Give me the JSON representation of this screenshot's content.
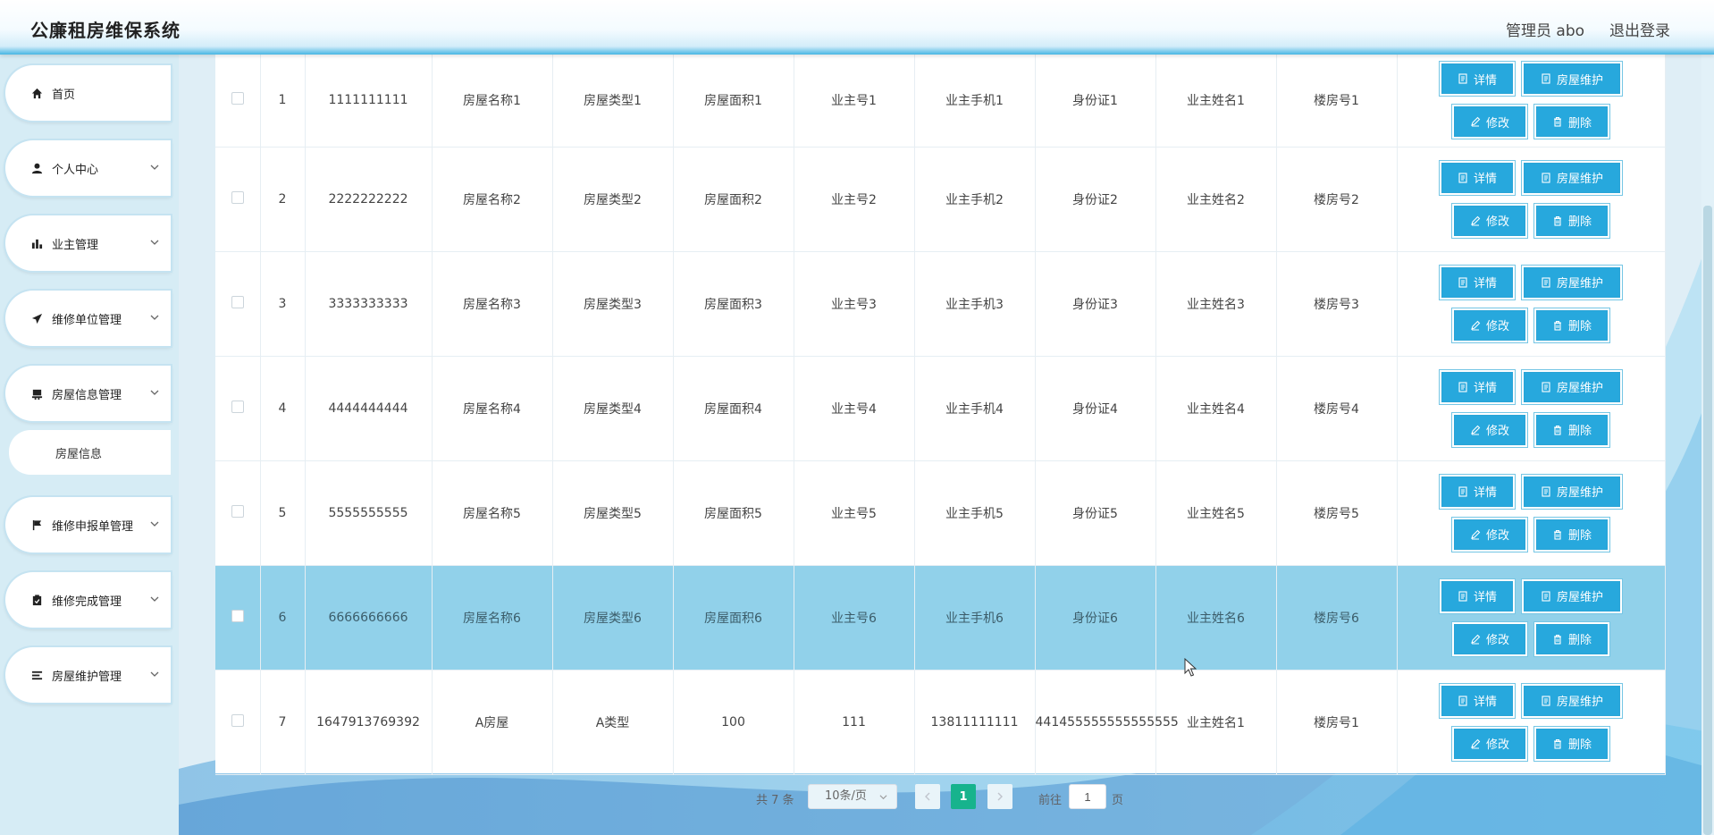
{
  "header": {
    "title": "公廉租房维保系统",
    "user": "管理员 abo",
    "logout": "退出登录"
  },
  "sidebar": {
    "items": [
      {
        "label": "首页",
        "icon": "home-icon"
      },
      {
        "label": "个人中心",
        "icon": "user-icon"
      },
      {
        "label": "业主管理",
        "icon": "bar-chart-icon"
      },
      {
        "label": "维修单位管理",
        "icon": "paper-plane-icon"
      },
      {
        "label": "房屋信息管理",
        "icon": "house-icon"
      },
      {
        "label": "维修申报单管理",
        "icon": "flag-icon"
      },
      {
        "label": "维修完成管理",
        "icon": "clipboard-icon"
      },
      {
        "label": "房屋维护管理",
        "icon": "list-icon"
      }
    ],
    "subitem": "房屋信息"
  },
  "table": {
    "rows": [
      [
        "1",
        "1111111111",
        "房屋名称1",
        "房屋类型1",
        "房屋面积1",
        "业主号1",
        "业主手机1",
        "身份证1",
        "业主姓名1",
        "楼房号1"
      ],
      [
        "2",
        "2222222222",
        "房屋名称2",
        "房屋类型2",
        "房屋面积2",
        "业主号2",
        "业主手机2",
        "身份证2",
        "业主姓名2",
        "楼房号2"
      ],
      [
        "3",
        "3333333333",
        "房屋名称3",
        "房屋类型3",
        "房屋面积3",
        "业主号3",
        "业主手机3",
        "身份证3",
        "业主姓名3",
        "楼房号3"
      ],
      [
        "4",
        "4444444444",
        "房屋名称4",
        "房屋类型4",
        "房屋面积4",
        "业主号4",
        "业主手机4",
        "身份证4",
        "业主姓名4",
        "楼房号4"
      ],
      [
        "5",
        "5555555555",
        "房屋名称5",
        "房屋类型5",
        "房屋面积5",
        "业主号5",
        "业主手机5",
        "身份证5",
        "业主姓名5",
        "楼房号5"
      ],
      [
        "6",
        "6666666666",
        "房屋名称6",
        "房屋类型6",
        "房屋面积6",
        "业主号6",
        "业主手机6",
        "身份证6",
        "业主姓名6",
        "楼房号6"
      ],
      [
        "7",
        "1647913769392",
        "A房屋",
        "A类型",
        "100",
        "111",
        "13811111111",
        "441455555555555555",
        "业主姓名1",
        "楼房号1"
      ]
    ],
    "highlighted_row": 6,
    "buttons": {
      "detail": "详情",
      "maintain": "房屋维护",
      "edit": "修改",
      "delete": "删除"
    }
  },
  "pagination": {
    "total": "共 7 条",
    "page_size": "10条/页",
    "current_page": "1",
    "goto_label": "前往",
    "goto_value": "1",
    "goto_unit": "页"
  },
  "colors": {
    "button": "#27a8dd",
    "highlight_row": "#91d1ea",
    "active_page": "#17b38d"
  }
}
